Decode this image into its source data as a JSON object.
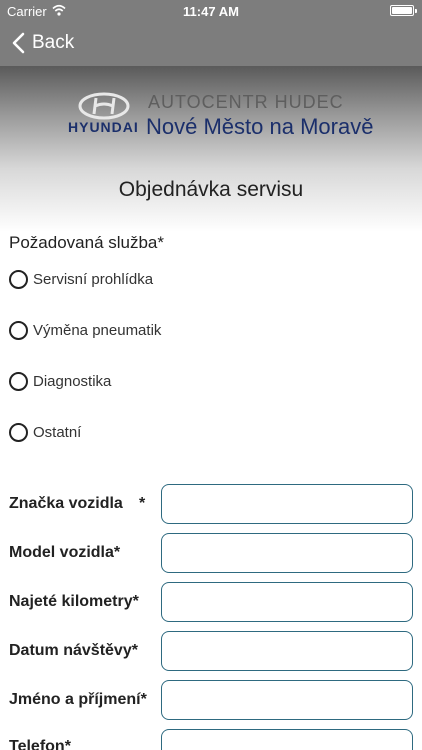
{
  "status_bar": {
    "carrier": "Carrier",
    "time": "11:47 AM"
  },
  "nav": {
    "back_label": "Back"
  },
  "header": {
    "brand_word": "HYUNDAI",
    "dealer_name": "AUTOCENTR HUDEC",
    "dealer_city": "Nové Město na Moravě"
  },
  "title": "Objednávka servisu",
  "service": {
    "label": "Požadovaná služba*",
    "options": [
      "Servisní prohlídka",
      "Výměna pneumatik",
      "Diagnostika",
      "Ostatní"
    ]
  },
  "form": {
    "brand_label": "Značka vozidla",
    "brand_star": "*",
    "model_label": "Model vozidla*",
    "mileage_label": "Najeté kilometry*",
    "date_label": "Datum návštěvy*",
    "name_label": "Jméno a příjmení*",
    "phone_label": "Telefon*",
    "brand_value": "",
    "model_value": "",
    "mileage_value": "",
    "date_value": "",
    "name_value": "",
    "phone_value": ""
  },
  "colors": {
    "nav_bg": "#7d7d7d",
    "input_border": "#2e6a80",
    "brand_blue": "#1b2f6b"
  },
  "icons": {
    "back": "chevron-left-icon",
    "wifi": "wifi-icon",
    "battery": "battery-icon",
    "logo": "hyundai-logo-icon"
  }
}
